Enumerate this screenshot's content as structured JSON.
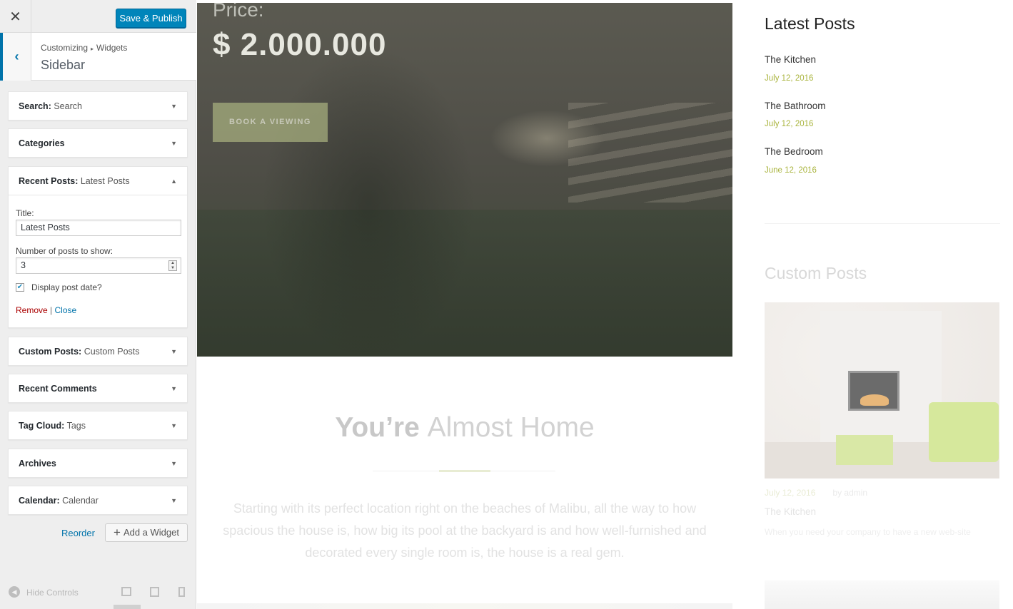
{
  "customizer": {
    "close_icon": "close-icon",
    "save_label": "Save & Publish",
    "breadcrumb": {
      "root": "Customizing",
      "sep": "▸",
      "current": "Widgets"
    },
    "section_title": "Sidebar",
    "widgets": [
      {
        "type": "Search:",
        "name": "Search"
      },
      {
        "type": "Categories",
        "name": ""
      },
      {
        "type": "Recent Posts:",
        "name": "Latest Posts"
      },
      {
        "type": "Custom Posts:",
        "name": "Custom Posts"
      },
      {
        "type": "Recent Comments",
        "name": ""
      },
      {
        "type": "Tag Cloud:",
        "name": "Tags"
      },
      {
        "type": "Archives",
        "name": ""
      },
      {
        "type": "Calendar:",
        "name": "Calendar"
      }
    ],
    "expanded_form": {
      "title_label": "Title:",
      "title_value": "Latest Posts",
      "count_label": "Number of posts to show:",
      "count_value": "3",
      "show_date_label": "Display post date?",
      "show_date_checked": true,
      "remove_label": "Remove",
      "link_sep": "|",
      "close_label": "Close"
    },
    "reorder_label": "Reorder",
    "add_widget_label": "Add a Widget",
    "hide_controls_label": "Hide Controls",
    "accent_color": "#0085ba"
  },
  "preview": {
    "hero": {
      "price_label": "Price:",
      "price_value": "$ 2.000.000",
      "cta_label": "BOOK A VIEWING"
    },
    "intro": {
      "heading_bold": "You’re",
      "heading_light": "Almost Home",
      "text": "Starting with its perfect location right on the beaches of Malibu, all the way to how spacious the house is, how big its pool at the backyard is and how well-furnished and decorated every single room is, the house is a real gem."
    },
    "sidebar": {
      "latest_posts_title": "Latest Posts",
      "posts": [
        {
          "title": "The Kitchen",
          "date": "July 12, 2016"
        },
        {
          "title": "The Bathroom",
          "date": "July 12, 2016"
        },
        {
          "title": "The Bedroom",
          "date": "June 12, 2016"
        }
      ],
      "custom_posts_title": "Custom Posts",
      "custom_post": {
        "date": "July 12, 2016",
        "author": "by admin",
        "title": "The Kitchen",
        "excerpt": "When you need your company to have a new web-site"
      }
    },
    "date_color": "#a9b43d"
  }
}
